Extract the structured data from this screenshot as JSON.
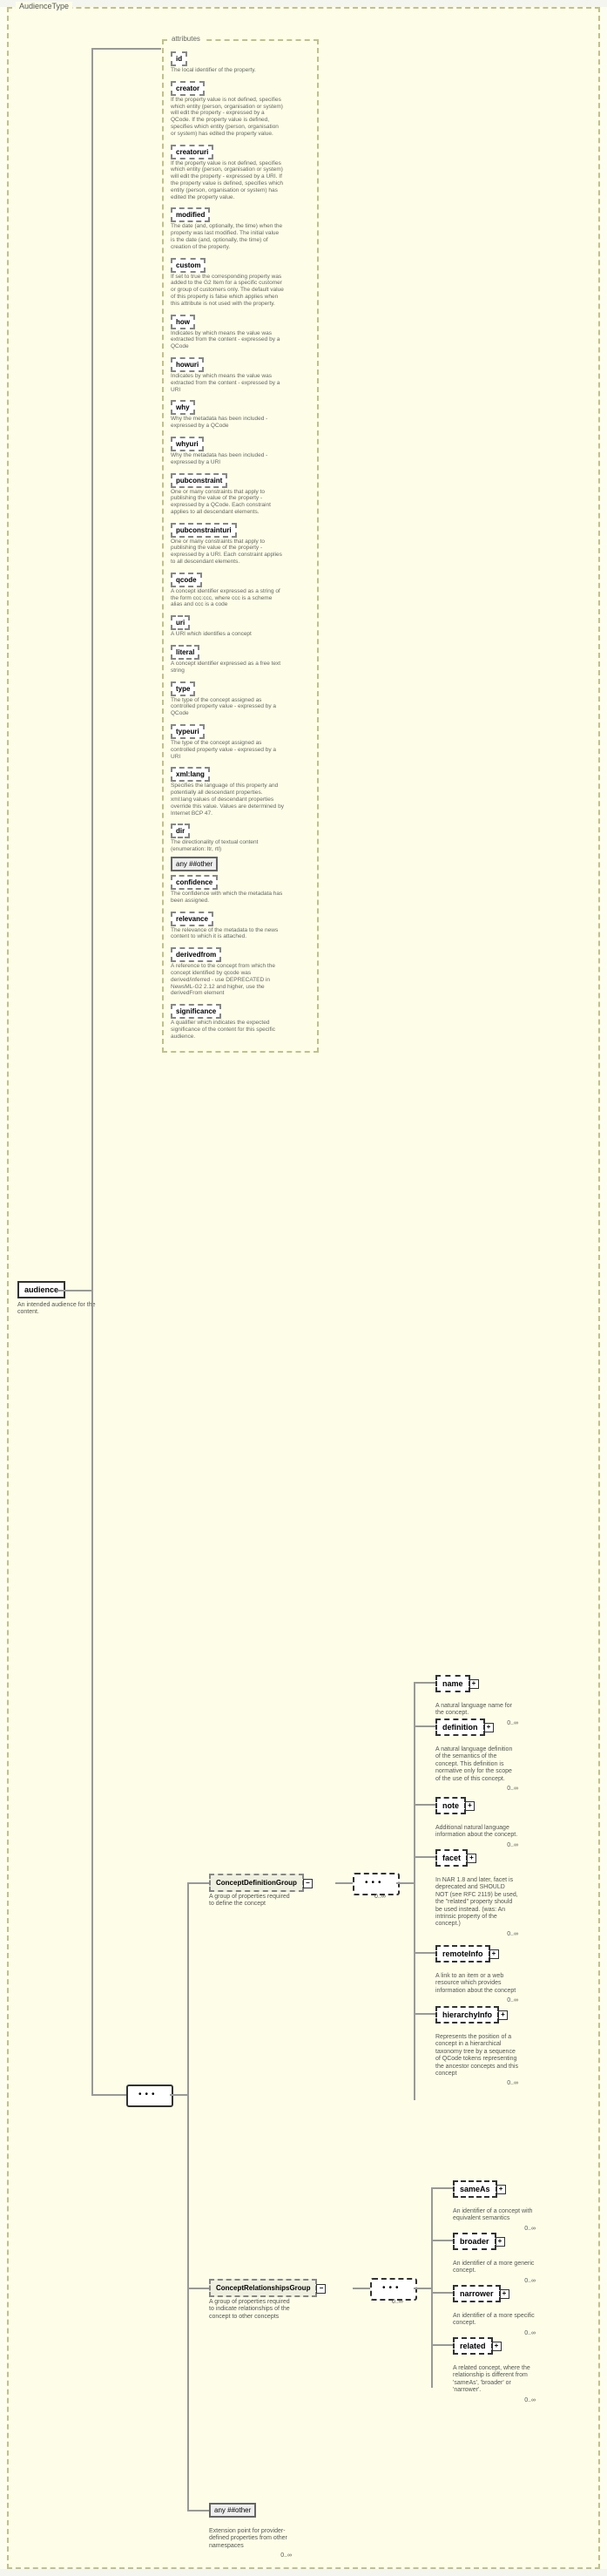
{
  "type_name": "AudienceType",
  "root": {
    "name": "audience",
    "desc": "An intended audience for the content."
  },
  "attributes_label": "attributes",
  "attrs": [
    {
      "name": "id",
      "desc": "The local identifier of the property."
    },
    {
      "name": "creator",
      "desc": "If the property value is not defined, specifies which entity (person, organisation or system) will edit the property - expressed by a QCode. If the property value is defined, specifies which entity (person, organisation or system) has edited the property value."
    },
    {
      "name": "creatoruri",
      "desc": "If the property value is not defined, specifies which entity (person, organisation or system) will edit the property - expressed by a URI. If the property value is defined, specifies which entity (person, organisation or system) has edited the property value."
    },
    {
      "name": "modified",
      "desc": "The date (and, optionally, the time) when the property was last modified. The initial value is the date (and, optionally, the time) of creation of the property."
    },
    {
      "name": "custom",
      "desc": "If set to true the corresponding property was added to the G2 Item for a specific customer or group of customers only. The default value of this property is false which applies when this attribute is not used with the property."
    },
    {
      "name": "how",
      "desc": "Indicates by which means the value was extracted from the content - expressed by a QCode"
    },
    {
      "name": "howuri",
      "desc": "Indicates by which means the value was extracted from the content - expressed by a URI"
    },
    {
      "name": "why",
      "desc": "Why the metadata has been included - expressed by a QCode"
    },
    {
      "name": "whyuri",
      "desc": "Why the metadata has been included - expressed by a URI"
    },
    {
      "name": "pubconstraint",
      "desc": "One or many constraints that apply to publishing the value of the property - expressed by a QCode. Each constraint applies to all descendant elements."
    },
    {
      "name": "pubconstrainturi",
      "desc": "One or many constraints that apply to publishing the value of the property - expressed by a URI. Each constraint applies to all descendant elements."
    },
    {
      "name": "qcode",
      "desc": "A concept identifier expressed as a string of the form ccc:ccc, where ccc is a scheme alias and ccc is a code"
    },
    {
      "name": "uri",
      "desc": "A URI which identifies a concept"
    },
    {
      "name": "literal",
      "desc": "A concept identifier expressed as a free text string"
    },
    {
      "name": "type",
      "desc": "The type of the concept assigned as controlled property value - expressed by a QCode"
    },
    {
      "name": "typeuri",
      "desc": "The type of the concept assigned as controlled property value - expressed by a URI"
    },
    {
      "name": "xml:lang",
      "desc": "Specifies the language of this property and potentially all descendant properties. xml:lang values of descendant properties override this value. Values are determined by Internet BCP 47."
    },
    {
      "name": "dir",
      "desc": "The directionality of textual content (enumeration: ltr, rtl)"
    },
    {
      "name": "any ##other",
      "desc": "",
      "any": true
    },
    {
      "name": "confidence",
      "desc": "The confidence with which the metadata has been assigned."
    },
    {
      "name": "relevance",
      "desc": "The relevance of the metadata to the news content to which it is attached."
    },
    {
      "name": "derivedfrom",
      "desc": "A reference to the concept from which the concept identified by qcode was derived/inferred - use DEPRECATED in NewsML-G2 2.12 and higher, use the derivedFrom element"
    },
    {
      "name": "significance",
      "desc": "A qualifier which indicates the expected significance of the content for this specific audience."
    }
  ],
  "groups": {
    "def": {
      "name": "ConceptDefinitionGroup",
      "desc": "A group of properties required to define the concept"
    },
    "rel": {
      "name": "ConceptRelationshipsGroup",
      "desc": "A group of properties required to indicate relationships of the concept to other concepts"
    }
  },
  "any_other": {
    "label": "any ##other",
    "occ": "0..∞",
    "desc": "Extension point for provider-defined properties from other namespaces"
  },
  "def_children": [
    {
      "name": "name",
      "desc": "A natural language name for the concept.",
      "occ": "0..∞"
    },
    {
      "name": "definition",
      "desc": "A natural language definition of the semantics of the concept. This definition is normative only for the scope of the use of this concept.",
      "occ": "0..∞"
    },
    {
      "name": "note",
      "desc": "Additional natural language information about the concept.",
      "occ": "0..∞"
    },
    {
      "name": "facet",
      "desc": "In NAR 1.8 and later, facet is deprecated and SHOULD NOT (see RFC 2119) be used, the \"related\" property should be used instead. (was: An intrinsic property of the concept.)",
      "occ": "0..∞"
    },
    {
      "name": "remoteInfo",
      "desc": "A link to an item or a web resource which provides information about the concept",
      "occ": "0..∞"
    },
    {
      "name": "hierarchyInfo",
      "desc": "Represents the position of a concept in a hierarchical taxonomy tree by a sequence of QCode tokens representing the ancestor concepts and this concept",
      "occ": "0..∞"
    }
  ],
  "rel_children": [
    {
      "name": "sameAs",
      "desc": "An identifier of a concept with equivalent semantics",
      "occ": "0..∞"
    },
    {
      "name": "broader",
      "desc": "An identifier of a more generic concept.",
      "occ": "0..∞"
    },
    {
      "name": "narrower",
      "desc": "An identifier of a more specific concept.",
      "occ": "0..∞"
    },
    {
      "name": "related",
      "desc": "A related concept, where the relationship is different from 'sameAs', 'broader' or 'narrower'.",
      "occ": "0..∞"
    }
  ],
  "occ_label": "0..∞"
}
